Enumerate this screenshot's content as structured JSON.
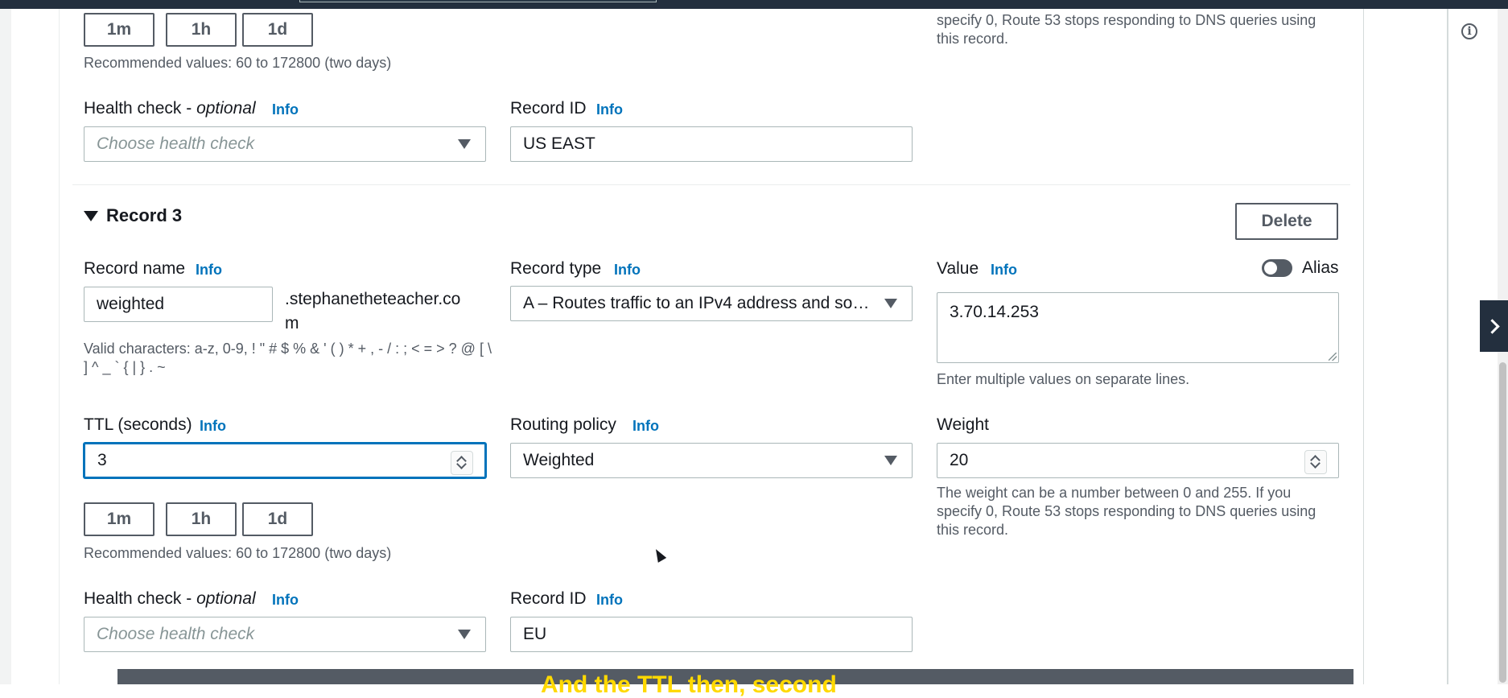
{
  "top_section": {
    "ttl_quick": [
      "1m",
      "1h",
      "1d"
    ],
    "recommended": "Recommended values: 60 to 172800 (two days)",
    "weight_hint_tail": "specify 0, Route 53 stops responding to DNS queries using this record.",
    "health_check_label": "Health check - ",
    "optional": "optional",
    "health_check_placeholder": "Choose health check",
    "record_id_label": "Record ID",
    "record_id_value": "US EAST",
    "info": "Info"
  },
  "record3": {
    "title": "Record 3",
    "delete_label": "Delete",
    "record_name_label": "Record name",
    "record_name_value": "weighted",
    "domain_suffix": ".stephanetheteacher.com",
    "valid_chars": "Valid characters: a-z, 0-9, ! \" # $ % & ' ( ) * + , - / : ; < = > ? @ [ \\ ] ^ _ ` { | } . ~",
    "record_type_label": "Record type",
    "record_type_value": "A – Routes traffic to an IPv4 address and so…",
    "value_label": "Value",
    "alias_label": "Alias",
    "value_text": "3.70.14.253",
    "value_hint": "Enter multiple values on separate lines.",
    "ttl_label": "TTL (seconds)",
    "ttl_value": "3",
    "routing_policy_label": "Routing policy",
    "routing_policy_value": "Weighted",
    "weight_label": "Weight",
    "weight_value": "20",
    "weight_hint": "The weight can be a number between 0 and 255. If you specify 0, Route 53 stops responding to DNS queries using this record.",
    "ttl_quick": [
      "1m",
      "1h",
      "1d"
    ],
    "recommended": "Recommended values: 60 to 172800 (two days)",
    "health_check_label": "Health check - ",
    "optional": "optional",
    "health_check_placeholder": "Choose health check",
    "record_id_label": "Record ID",
    "record_id_value": "EU",
    "info": "Info"
  },
  "caption": "And the TTL then, second",
  "icons": {
    "info_circle": "info-circle-icon",
    "expand_panel": "chevron-right-icon"
  },
  "colors": {
    "link": "#0073bb",
    "caption_text": "#ffd900",
    "header": "#232f3e"
  }
}
